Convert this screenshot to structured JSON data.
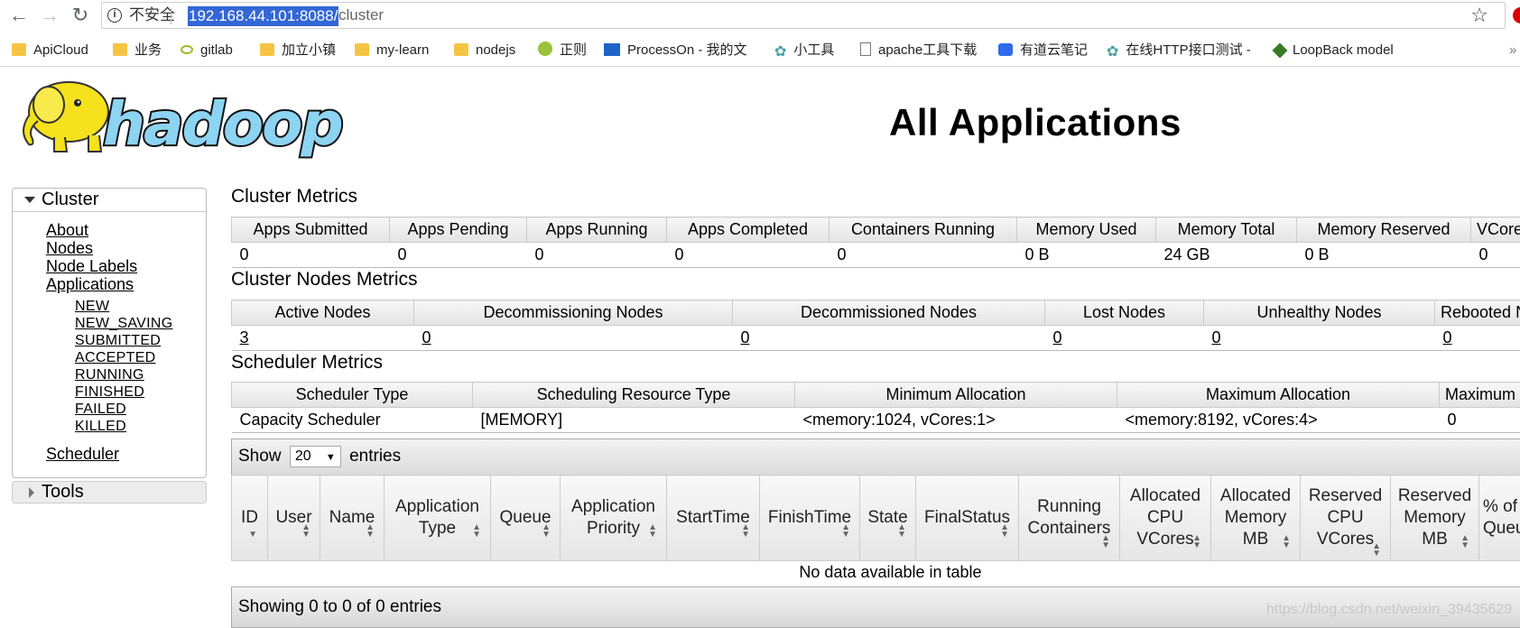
{
  "browser": {
    "security_label": "不安全",
    "url_host": "192.168.44.101:8088/",
    "url_path": "cluster",
    "bookmarks": [
      "ApiCloud",
      "业务",
      "gitlab",
      "加立小镇",
      "my-learn",
      "nodejs",
      "正则",
      "ProcessOn - 我的文",
      "小工具",
      "apache工具下载",
      "有道云笔记",
      "在线HTTP接口测试 -",
      "LoopBack model"
    ],
    "colors": {
      "selection": "#3367d6",
      "folder": "#f5c443"
    }
  },
  "logo": {
    "text": "hadoop",
    "icon": "hadoop-elephant-logo"
  },
  "page": {
    "title": "All Applications"
  },
  "nav": {
    "cluster_label": "Cluster",
    "links": [
      "About",
      "Nodes",
      "Node Labels",
      "Applications"
    ],
    "states": [
      "NEW",
      "NEW_SAVING",
      "SUBMITTED",
      "ACCEPTED",
      "RUNNING",
      "FINISHED",
      "FAILED",
      "KILLED"
    ],
    "scheduler": "Scheduler",
    "tools_label": "Tools"
  },
  "cluster_metrics": {
    "title": "Cluster Metrics",
    "headers": [
      "Apps Submitted",
      "Apps Pending",
      "Apps Running",
      "Apps Completed",
      "Containers Running",
      "Memory Used",
      "Memory Total",
      "Memory Reserved",
      "VCores Used"
    ],
    "values": [
      "0",
      "0",
      "0",
      "0",
      "0",
      "0 B",
      "24 GB",
      "0 B",
      "0"
    ]
  },
  "node_metrics": {
    "title": "Cluster Nodes Metrics",
    "headers": [
      "Active Nodes",
      "Decommissioning Nodes",
      "Decommissioned Nodes",
      "Lost Nodes",
      "Unhealthy Nodes",
      "Rebooted Nodes"
    ],
    "values": [
      "3",
      "0",
      "0",
      "0",
      "0",
      "0"
    ]
  },
  "scheduler_metrics": {
    "title": "Scheduler Metrics",
    "headers": [
      "Scheduler Type",
      "Scheduling Resource Type",
      "Minimum Allocation",
      "Maximum Allocation",
      "Maximum Cluster Application Priority"
    ],
    "values": [
      "Capacity Scheduler",
      "[MEMORY]",
      "<memory:1024, vCores:1>",
      "<memory:8192, vCores:4>",
      "0"
    ]
  },
  "apps_table": {
    "show_label": "Show",
    "entries_label": "entries",
    "page_length": "20",
    "headers": [
      "ID",
      "User",
      "Name",
      "Application Type",
      "Queue",
      "Application Priority",
      "StartTime",
      "FinishTime",
      "State",
      "FinalStatus",
      "Running Containers",
      "Allocated CPU VCores",
      "Allocated Memory MB",
      "Reserved CPU VCores",
      "Reserved Memory MB",
      "% of Queue"
    ],
    "empty_message": "No data available in table",
    "info": "Showing 0 to 0 of 0 entries"
  },
  "watermark": "https://blog.csdn.net/weixin_39435629"
}
